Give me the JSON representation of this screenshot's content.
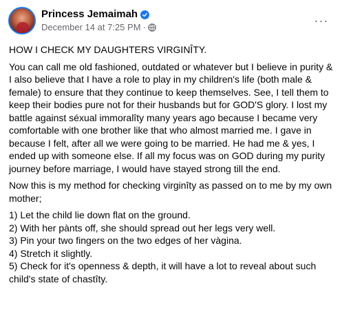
{
  "post": {
    "author_name": "Princess Jemaimah",
    "timestamp": "December 14 at 7:25 PM",
    "separator": "·",
    "more_options": "···",
    "verified_icon": "verified-badge-icon",
    "privacy_icon": "globe-icon",
    "colors": {
      "name": "#050505",
      "meta": "#65676b",
      "verified": "#1877f2",
      "text": "#050505"
    },
    "heading": "HOW I CHECK MY DAUGHTERS VIRGINÎTY.",
    "paragraph1": "You can call me old fashioned, outdated or whatever but I believe in purity & I also believe that I have a role to play in my children's life (both male & female) to ensure that they continue to keep themselves. See, I tell them to keep their bodies pure not for their husbands but for GOD'S glory. I lost my battle against séxual immoralîty many years ago because I became very comfortable with one brother like that who almost married me. I gave in because I felt, after all we were going to be married. He had me & yes, I ended up with someone else. If all my focus was on GOD during my purity journey before marriage, I would have stayed strong till the end.",
    "paragraph2": "Now this is my method for checking virginîty as passed on to me by my own mother;",
    "steps": [
      "1) Let the child lie down flat on the ground.",
      "2) With her pànts off, she should spread out her legs very well.",
      "3) Pin your two fingers on the two edges of her vàgina.",
      "4) Stretch it slightly.",
      "5) Check for it's openness & depth, it will have a lot to reveal about such child's state of chastîty."
    ]
  }
}
